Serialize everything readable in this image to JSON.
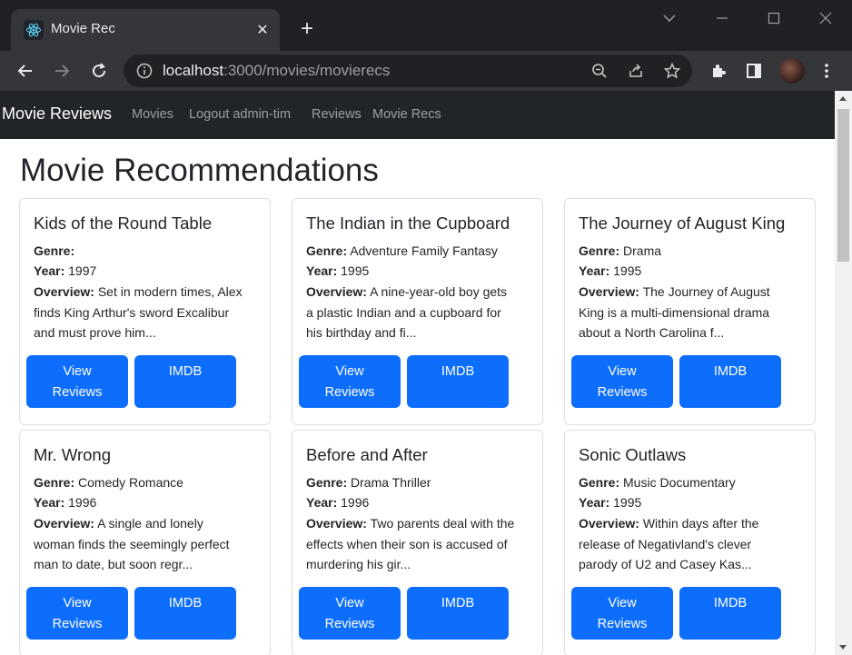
{
  "browser": {
    "tab_title": "Movie Rec",
    "tab_close": "✕",
    "new_tab": "+",
    "url_host": "localhost",
    "url_path": ":3000/movies/movierecs"
  },
  "navbar": {
    "brand": "Movie Reviews",
    "links": [
      "Movies",
      "Logout admin-tim",
      "Reviews",
      "Movie Recs"
    ]
  },
  "page": {
    "title": "Movie Recommendations"
  },
  "labels": {
    "genre": "Genre:",
    "year": "Year:",
    "overview": "Overview:",
    "view_reviews_1": "View",
    "view_reviews_2": "Reviews",
    "imdb": "IMDB"
  },
  "movies": [
    {
      "title": "Kids of the Round Table",
      "genre": "",
      "year": "1997",
      "overview_lines": [
        "Set in modern times, Alex",
        "finds King Arthur's sword Excalibur",
        "and must prove him..."
      ]
    },
    {
      "title": "The Indian in the Cupboard",
      "genre": "Adventure Family Fantasy",
      "year": "1995",
      "overview_lines": [
        "A nine-year-old boy gets",
        "a plastic Indian and a cupboard for",
        "his birthday and fi..."
      ]
    },
    {
      "title": "The Journey of August King",
      "genre": "Drama",
      "year": "1995",
      "overview_lines": [
        "The Journey of August",
        "King is a multi-dimensional drama",
        "about a North Carolina f..."
      ]
    },
    {
      "title": "Mr. Wrong",
      "genre": "Comedy Romance",
      "year": "1996",
      "overview_lines": [
        "A single and lonely",
        "woman finds the seemingly perfect",
        "man to date, but soon regr..."
      ]
    },
    {
      "title": "Before and After",
      "genre": "Drama Thriller",
      "year": "1996",
      "overview_lines": [
        "Two parents deal with the",
        "effects when their son is accused of",
        "murdering his gir..."
      ]
    },
    {
      "title": "Sonic Outlaws",
      "genre": "Music Documentary",
      "year": "1995",
      "overview_lines": [
        "Within days after the",
        "release of Negativland's clever",
        "parody of U2 and Casey Kas..."
      ]
    }
  ]
}
